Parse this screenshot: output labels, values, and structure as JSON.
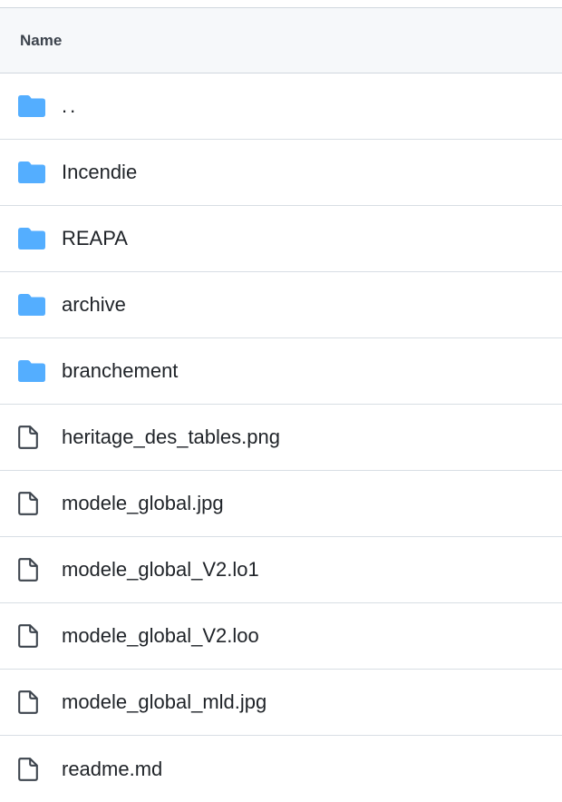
{
  "header": {
    "name_label": "Name"
  },
  "colors": {
    "folder": "#54aeff",
    "file_outline": "#3d444d",
    "header_bg": "#f6f8fa",
    "border": "#d0d7de"
  },
  "rows": [
    {
      "type": "folder",
      "icon": "folder-icon",
      "label": ".."
    },
    {
      "type": "folder",
      "icon": "folder-icon",
      "label": "Incendie"
    },
    {
      "type": "folder",
      "icon": "folder-icon",
      "label": "REAPA"
    },
    {
      "type": "folder",
      "icon": "folder-icon",
      "label": "archive"
    },
    {
      "type": "folder",
      "icon": "folder-icon",
      "label": "branchement"
    },
    {
      "type": "file",
      "icon": "file-icon",
      "label": "heritage_des_tables.png"
    },
    {
      "type": "file",
      "icon": "file-icon",
      "label": "modele_global.jpg"
    },
    {
      "type": "file",
      "icon": "file-icon",
      "label": "modele_global_V2.lo1"
    },
    {
      "type": "file",
      "icon": "file-icon",
      "label": "modele_global_V2.loo"
    },
    {
      "type": "file",
      "icon": "file-icon",
      "label": "modele_global_mld.jpg"
    },
    {
      "type": "file",
      "icon": "file-icon",
      "label": "readme.md"
    }
  ]
}
